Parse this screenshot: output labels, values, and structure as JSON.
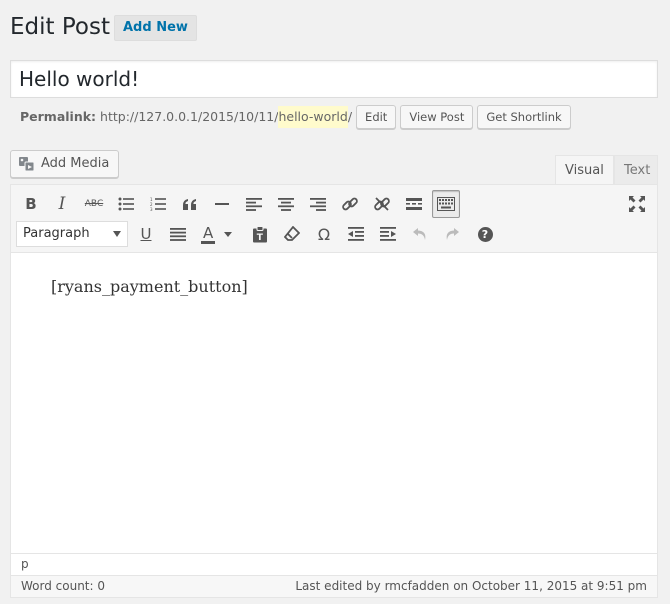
{
  "header": {
    "title": "Edit Post",
    "add_new_label": "Add New"
  },
  "post": {
    "title": "Hello world!"
  },
  "permalink": {
    "label": "Permalink:",
    "url_prefix": "http://127.0.0.1/2015/10/11/",
    "slug": "hello-world",
    "url_suffix": "/",
    "buttons": {
      "edit": "Edit",
      "view_post": "View Post",
      "get_shortlink": "Get Shortlink"
    }
  },
  "media": {
    "add_media_label": "Add Media",
    "icon": "media-icon"
  },
  "editor_tabs": {
    "visual": "Visual",
    "text": "Text",
    "active": "Visual"
  },
  "toolbar": {
    "row1": [
      "bold-icon",
      "italic-icon",
      "strikethrough-icon",
      "bulleted-list-icon",
      "numbered-list-icon",
      "blockquote-icon",
      "horizontal-line-icon",
      "align-left-icon",
      "align-center-icon",
      "align-right-icon",
      "insert-link-icon",
      "remove-link-icon",
      "read-more-icon",
      "toolbar-toggle-icon",
      "fullscreen-icon"
    ],
    "row2": [
      "underline-icon",
      "justify-icon",
      "text-color-icon",
      "paste-as-text-icon",
      "clear-formatting-icon",
      "special-character-icon",
      "outdent-icon",
      "indent-icon",
      "undo-icon",
      "redo-icon",
      "help-icon"
    ],
    "format_select": "Paragraph",
    "bold": "B",
    "italic": "I",
    "strike": "ABC",
    "underline": "U",
    "text_color": "A",
    "omega": "Ω",
    "help": "?"
  },
  "content": {
    "text": "[ryans_payment_button]"
  },
  "path": "p",
  "status": {
    "word_count": "Word count: 0",
    "last_edited": "Last edited by rmcfadden on October 11, 2015 at 9:51 pm"
  },
  "colors": {
    "link": "#0073aa",
    "background": "#f1f1f1",
    "slug_highlight": "#fffbcc"
  }
}
